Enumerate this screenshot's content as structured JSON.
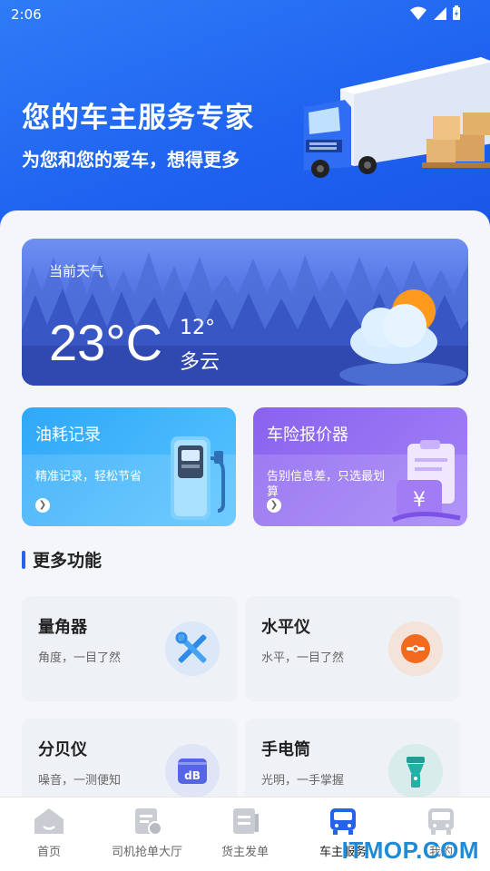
{
  "status_bar": {
    "time": "2:06"
  },
  "hero": {
    "title": "您的车主服务专家",
    "subtitle": "为您和您的爱车，想得更多"
  },
  "weather": {
    "label": "当前天气",
    "temperature": "23°C",
    "low": "12°",
    "condition": "多云",
    "icon": "partly-cloudy-icon"
  },
  "feature_cards": [
    {
      "title": "油耗记录",
      "desc": "精准记录，轻松节省",
      "icon": "fuel-pump-icon",
      "color": "#3aaef9"
    },
    {
      "title": "车险报价器",
      "desc": "告别信息差，只选最划算",
      "icon": "price-document-icon",
      "color": "#9470f1"
    }
  ],
  "more": {
    "title": "更多功能",
    "tools": [
      {
        "name": "量角器",
        "desc": "角度，一目了然",
        "icon": "protractor-tools-icon"
      },
      {
        "name": "水平仪",
        "desc": "水平，一目了然",
        "icon": "level-icon"
      },
      {
        "name": "分贝仪",
        "desc": "噪音，一测便知",
        "icon": "decibel-icon"
      },
      {
        "name": "手电筒",
        "desc": "光明，一手掌握",
        "icon": "flashlight-icon"
      }
    ]
  },
  "tabbar": {
    "tabs": [
      {
        "label": "首页",
        "icon": "home-icon",
        "active": false
      },
      {
        "label": "司机抢单大厅",
        "icon": "order-hall-icon",
        "active": false
      },
      {
        "label": "货主发单",
        "icon": "publish-order-icon",
        "active": false
      },
      {
        "label": "车主服务",
        "icon": "bus-icon",
        "active": true
      },
      {
        "label": "我的",
        "icon": "profile-bus-icon",
        "active": false
      }
    ]
  },
  "watermark": "ITMOP.COM",
  "colors": {
    "accent": "#2563eb",
    "hero": "#1f63f0",
    "active_tab": "#2563eb"
  }
}
